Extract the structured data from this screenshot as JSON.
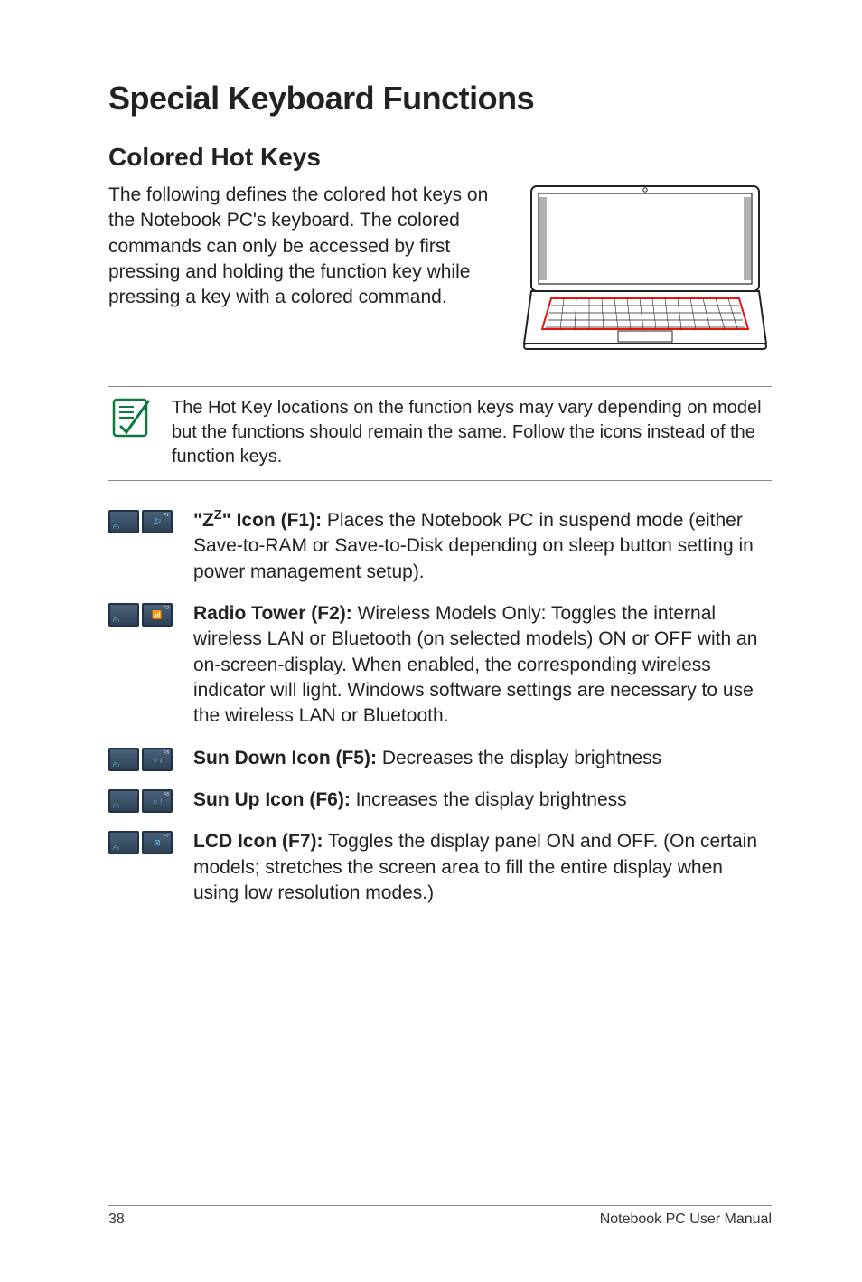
{
  "title": "Special Keyboard Functions",
  "section_title": "Colored Hot Keys",
  "intro": "The following defines the colored hot keys on the Notebook PC's keyboard. The colored commands can only be accessed by first pressing and holding the function key while pressing a key with a colored command.",
  "note": "The Hot Key locations on the function keys may vary depending on model but the functions should remain the same. Follow the icons instead of the function keys.",
  "hotkeys": [
    {
      "fkey": "F1",
      "icon": "Zᶻ",
      "label_bold": "\"Z",
      "label_sup": "Z",
      "label_bold2": "\" Icon (F1):",
      "desc": " Places the Notebook PC in suspend mode (either Save-to-RAM or Save-to-Disk depending on sleep button setting in power management setup)."
    },
    {
      "fkey": "F2",
      "icon": "📶",
      "label_bold": "Radio Tower (F2):",
      "desc": " Wireless Models Only: Toggles the internal wireless LAN or Bluetooth (on selected models) ON or OFF with an on-screen-display. When enabled, the corresponding wireless indicator will light. Windows software settings are necessary to use the wireless LAN or Bluetooth."
    },
    {
      "fkey": "F5",
      "icon": "☼↓",
      "label_bold": "Sun Down Icon (F5):",
      "desc": " Decreases the display brightness"
    },
    {
      "fkey": "F6",
      "icon": "☼↑",
      "label_bold": "Sun Up Icon (F6):",
      "desc": " Increases the display brightness"
    },
    {
      "fkey": "F7",
      "icon": "⊠",
      "label_bold": "LCD Icon (F7):",
      "desc": " Toggles the display panel ON and OFF. (On certain models; stretches the screen area to fill the entire display when using low resolution modes.)"
    }
  ],
  "footer": {
    "page": "38",
    "manual": "Notebook PC User Manual"
  }
}
